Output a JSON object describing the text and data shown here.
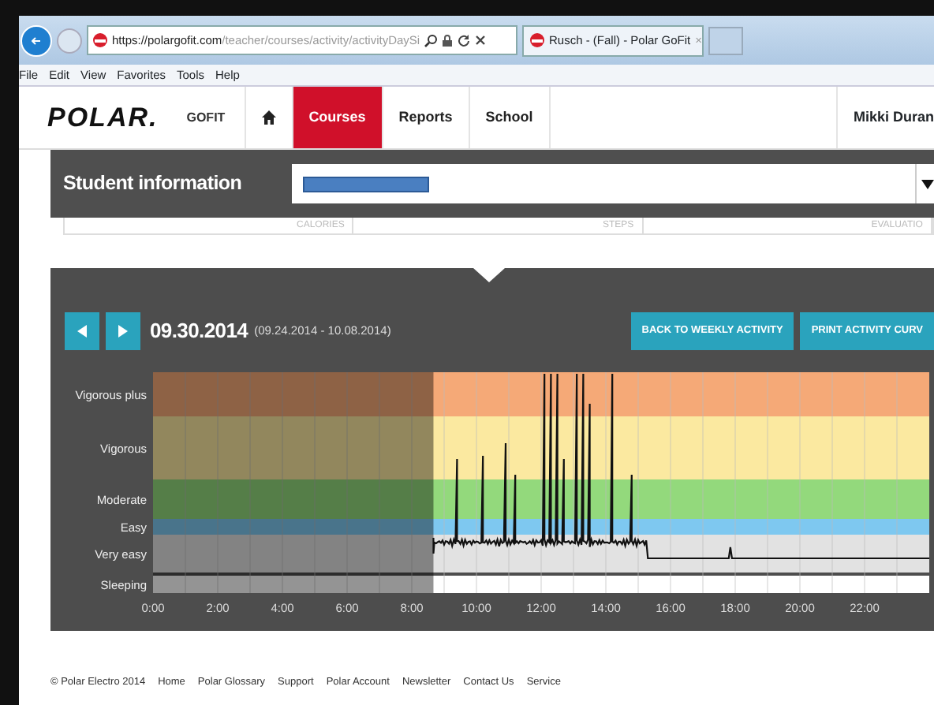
{
  "browser": {
    "url_host": "https://polargofit.com",
    "url_path": "/teacher/courses/activity/activityDaySi",
    "tab_title": "Rusch - (Fall) - Polar GoFit",
    "tab_close": "×",
    "menu": [
      "File",
      "Edit",
      "View",
      "Favorites",
      "Tools",
      "Help"
    ]
  },
  "site_nav": {
    "logo": "POLAR.",
    "product": "GOFIT",
    "items": [
      {
        "label": "Courses",
        "selected": true
      },
      {
        "label": "Reports",
        "selected": false
      },
      {
        "label": "School",
        "selected": false
      }
    ],
    "user": "Mikki Duran"
  },
  "student_bar": {
    "title": "Student information"
  },
  "summary_columns": [
    "CALORIES",
    "STEPS",
    "EVALUATIO"
  ],
  "day_view": {
    "date": "09.30.2014",
    "range": "(09.24.2014 - 10.08.2014)",
    "buttons": [
      "BACK TO WEEKLY ACTIVITY",
      "PRINT ACTIVITY CURV"
    ]
  },
  "activity_chart": {
    "zones": [
      {
        "label": "Vigorous plus",
        "color": "#f5a977"
      },
      {
        "label": "Vigorous",
        "color": "#fbe9a0"
      },
      {
        "label": "Moderate",
        "color": "#93d97c"
      },
      {
        "label": "Easy",
        "color": "#7ec8f0"
      },
      {
        "label": "Very easy",
        "color": "#e2e2e2"
      },
      {
        "label": "Sleeping",
        "color": "#ffffff"
      }
    ],
    "x_labels": [
      "0:00",
      "2:00",
      "4:00",
      "6:00",
      "8:00",
      "10:00",
      "12:00",
      "14:00",
      "16:00",
      "18:00",
      "20:00",
      "22:00"
    ]
  },
  "footer": {
    "copyright": "© Polar Electro 2014",
    "links": [
      "Home",
      "Polar Glossary",
      "Support",
      "Polar Account",
      "Newsletter",
      "Contact Us",
      "Service"
    ]
  }
}
